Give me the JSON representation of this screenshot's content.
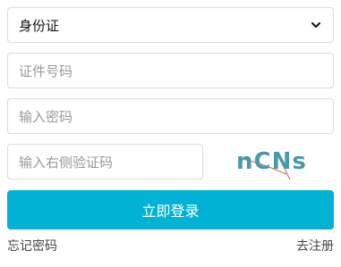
{
  "form": {
    "id_type": {
      "selected": "身份证"
    },
    "id_number": {
      "placeholder": "证件号码"
    },
    "password": {
      "placeholder": "输入密码"
    },
    "captcha": {
      "placeholder": "输入右侧验证码",
      "image_text": "nCNs"
    },
    "login_button": "立即登录",
    "forgot_password": "忘记密码",
    "register": "去注册"
  },
  "colors": {
    "primary": "#01b2d4",
    "captcha_text": "#4a9aa6",
    "border": "#dcdcdc"
  }
}
